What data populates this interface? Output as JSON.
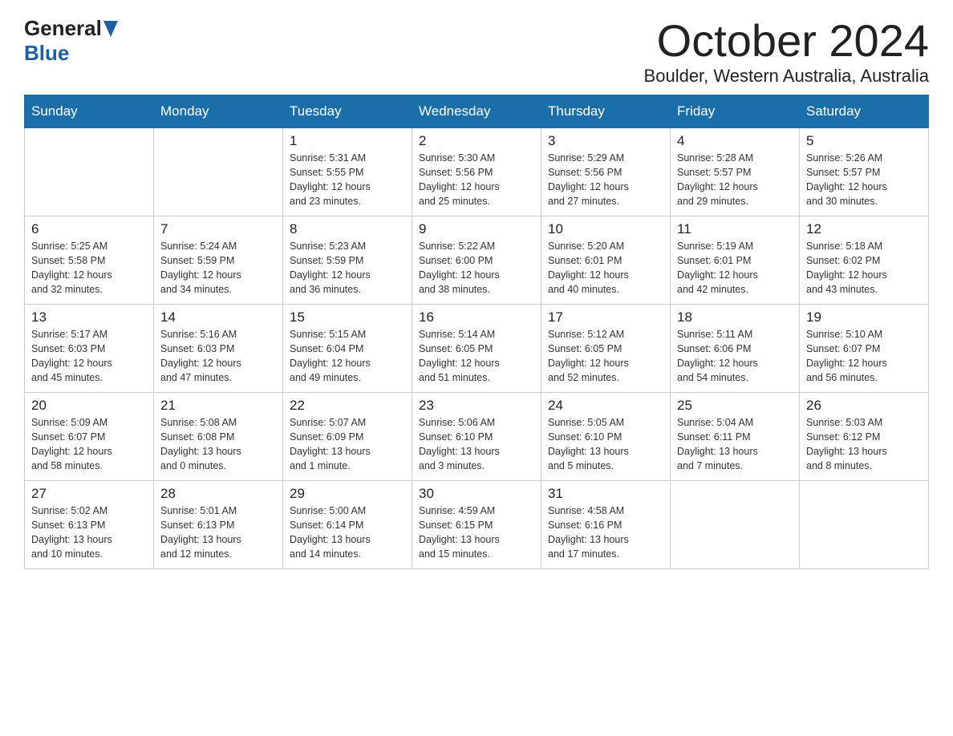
{
  "header": {
    "logo_general": "General",
    "logo_blue": "Blue",
    "month": "October 2024",
    "location": "Boulder, Western Australia, Australia"
  },
  "weekdays": [
    "Sunday",
    "Monday",
    "Tuesday",
    "Wednesday",
    "Thursday",
    "Friday",
    "Saturday"
  ],
  "weeks": [
    [
      {
        "day": "",
        "info": ""
      },
      {
        "day": "",
        "info": ""
      },
      {
        "day": "1",
        "info": "Sunrise: 5:31 AM\nSunset: 5:55 PM\nDaylight: 12 hours\nand 23 minutes."
      },
      {
        "day": "2",
        "info": "Sunrise: 5:30 AM\nSunset: 5:56 PM\nDaylight: 12 hours\nand 25 minutes."
      },
      {
        "day": "3",
        "info": "Sunrise: 5:29 AM\nSunset: 5:56 PM\nDaylight: 12 hours\nand 27 minutes."
      },
      {
        "day": "4",
        "info": "Sunrise: 5:28 AM\nSunset: 5:57 PM\nDaylight: 12 hours\nand 29 minutes."
      },
      {
        "day": "5",
        "info": "Sunrise: 5:26 AM\nSunset: 5:57 PM\nDaylight: 12 hours\nand 30 minutes."
      }
    ],
    [
      {
        "day": "6",
        "info": "Sunrise: 5:25 AM\nSunset: 5:58 PM\nDaylight: 12 hours\nand 32 minutes."
      },
      {
        "day": "7",
        "info": "Sunrise: 5:24 AM\nSunset: 5:59 PM\nDaylight: 12 hours\nand 34 minutes."
      },
      {
        "day": "8",
        "info": "Sunrise: 5:23 AM\nSunset: 5:59 PM\nDaylight: 12 hours\nand 36 minutes."
      },
      {
        "day": "9",
        "info": "Sunrise: 5:22 AM\nSunset: 6:00 PM\nDaylight: 12 hours\nand 38 minutes."
      },
      {
        "day": "10",
        "info": "Sunrise: 5:20 AM\nSunset: 6:01 PM\nDaylight: 12 hours\nand 40 minutes."
      },
      {
        "day": "11",
        "info": "Sunrise: 5:19 AM\nSunset: 6:01 PM\nDaylight: 12 hours\nand 42 minutes."
      },
      {
        "day": "12",
        "info": "Sunrise: 5:18 AM\nSunset: 6:02 PM\nDaylight: 12 hours\nand 43 minutes."
      }
    ],
    [
      {
        "day": "13",
        "info": "Sunrise: 5:17 AM\nSunset: 6:03 PM\nDaylight: 12 hours\nand 45 minutes."
      },
      {
        "day": "14",
        "info": "Sunrise: 5:16 AM\nSunset: 6:03 PM\nDaylight: 12 hours\nand 47 minutes."
      },
      {
        "day": "15",
        "info": "Sunrise: 5:15 AM\nSunset: 6:04 PM\nDaylight: 12 hours\nand 49 minutes."
      },
      {
        "day": "16",
        "info": "Sunrise: 5:14 AM\nSunset: 6:05 PM\nDaylight: 12 hours\nand 51 minutes."
      },
      {
        "day": "17",
        "info": "Sunrise: 5:12 AM\nSunset: 6:05 PM\nDaylight: 12 hours\nand 52 minutes."
      },
      {
        "day": "18",
        "info": "Sunrise: 5:11 AM\nSunset: 6:06 PM\nDaylight: 12 hours\nand 54 minutes."
      },
      {
        "day": "19",
        "info": "Sunrise: 5:10 AM\nSunset: 6:07 PM\nDaylight: 12 hours\nand 56 minutes."
      }
    ],
    [
      {
        "day": "20",
        "info": "Sunrise: 5:09 AM\nSunset: 6:07 PM\nDaylight: 12 hours\nand 58 minutes."
      },
      {
        "day": "21",
        "info": "Sunrise: 5:08 AM\nSunset: 6:08 PM\nDaylight: 13 hours\nand 0 minutes."
      },
      {
        "day": "22",
        "info": "Sunrise: 5:07 AM\nSunset: 6:09 PM\nDaylight: 13 hours\nand 1 minute."
      },
      {
        "day": "23",
        "info": "Sunrise: 5:06 AM\nSunset: 6:10 PM\nDaylight: 13 hours\nand 3 minutes."
      },
      {
        "day": "24",
        "info": "Sunrise: 5:05 AM\nSunset: 6:10 PM\nDaylight: 13 hours\nand 5 minutes."
      },
      {
        "day": "25",
        "info": "Sunrise: 5:04 AM\nSunset: 6:11 PM\nDaylight: 13 hours\nand 7 minutes."
      },
      {
        "day": "26",
        "info": "Sunrise: 5:03 AM\nSunset: 6:12 PM\nDaylight: 13 hours\nand 8 minutes."
      }
    ],
    [
      {
        "day": "27",
        "info": "Sunrise: 5:02 AM\nSunset: 6:13 PM\nDaylight: 13 hours\nand 10 minutes."
      },
      {
        "day": "28",
        "info": "Sunrise: 5:01 AM\nSunset: 6:13 PM\nDaylight: 13 hours\nand 12 minutes."
      },
      {
        "day": "29",
        "info": "Sunrise: 5:00 AM\nSunset: 6:14 PM\nDaylight: 13 hours\nand 14 minutes."
      },
      {
        "day": "30",
        "info": "Sunrise: 4:59 AM\nSunset: 6:15 PM\nDaylight: 13 hours\nand 15 minutes."
      },
      {
        "day": "31",
        "info": "Sunrise: 4:58 AM\nSunset: 6:16 PM\nDaylight: 13 hours\nand 17 minutes."
      },
      {
        "day": "",
        "info": ""
      },
      {
        "day": "",
        "info": ""
      }
    ]
  ]
}
